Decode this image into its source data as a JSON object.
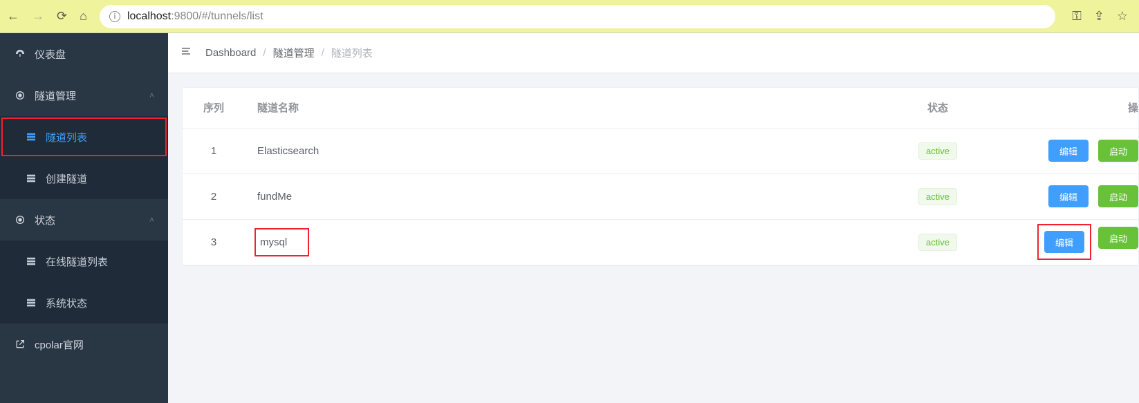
{
  "browser": {
    "url_host": "localhost",
    "url_path": ":9800/#/tunnels/list"
  },
  "sidebar": {
    "dashboard": "仪表盘",
    "tunnel_mgmt": "隧道管理",
    "tunnel_list": "隧道列表",
    "create_tunnel": "创建隧道",
    "status": "状态",
    "online_tunnels": "在线隧道列表",
    "system_status": "系统状态",
    "cpolar_site": "cpolar官网"
  },
  "breadcrumb": {
    "dashboard": "Dashboard",
    "tunnel_mgmt": "隧道管理",
    "tunnel_list": "隧道列表"
  },
  "table": {
    "headers": {
      "index": "序列",
      "name": "隧道名称",
      "status": "状态",
      "ops": "操"
    },
    "rows": [
      {
        "idx": "1",
        "name": "Elasticsearch",
        "status": "active"
      },
      {
        "idx": "2",
        "name": "fundMe",
        "status": "active"
      },
      {
        "idx": "3",
        "name": "mysql",
        "status": "active"
      }
    ],
    "buttons": {
      "edit": "编辑",
      "start": "启动"
    }
  }
}
